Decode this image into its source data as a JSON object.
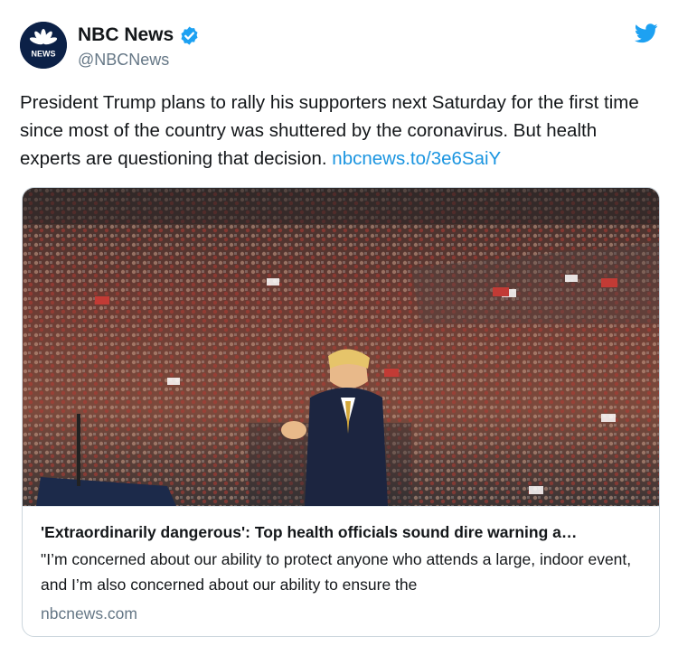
{
  "account": {
    "display_name": "NBC News",
    "handle": "@NBCNews",
    "avatar_label": "NEWS",
    "verified": true
  },
  "icons": {
    "avatar": "nbc-peacock-icon",
    "verified": "verified-badge-icon",
    "platform": "twitter-bird-icon"
  },
  "colors": {
    "link": "#1b95e0",
    "verified": "#1da1f2",
    "avatar_bg": "#0c2147",
    "secondary_text": "#657786"
  },
  "tweet": {
    "text": "President Trump plans to rally his supporters next Saturday for the first time since most of the country was shuttered by the coronavirus. But health experts are questioning that decision. ",
    "link_text": "nbcnews.to/3e6SaiY"
  },
  "card": {
    "title": "'Extraordinarily dangerous': Top health officials sound dire warning a…",
    "description": "\"I’m concerned about our ability to protect anyone who attends a large, indoor event, and I’m also concerned about our ability to ensure the",
    "domain": "nbcnews.com"
  }
}
